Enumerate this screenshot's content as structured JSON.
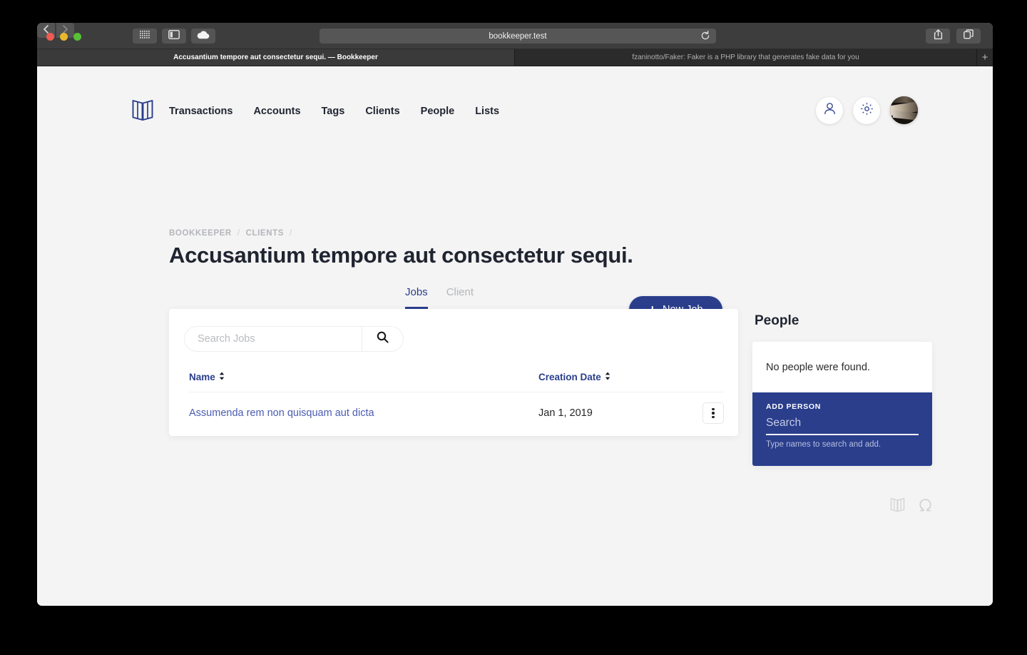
{
  "browser": {
    "address": "bookkeeper.test",
    "reload_icon": "reload-icon",
    "back_icon": "back-arrow-icon",
    "forward_icon": "forward-arrow-icon",
    "grid_icon": "app-grid-icon",
    "sidebar_icon": "sidebar-toggle-icon",
    "cloud_icon": "icloud-icon",
    "share_icon": "share-icon",
    "tab_overview_icon": "tab-overview-icon",
    "new_tab_label": "+",
    "tabs": [
      {
        "title": "Accusantium tempore aut consectetur sequi. — Bookkeeper",
        "active": true
      },
      {
        "title": "fzaninotto/Faker: Faker is a PHP library that generates fake data for you",
        "active": false
      }
    ]
  },
  "app": {
    "logo_icon": "open-book-logo-icon",
    "nav": [
      {
        "label": "Transactions"
      },
      {
        "label": "Accounts"
      },
      {
        "label": "Tags"
      },
      {
        "label": "Clients"
      },
      {
        "label": "People"
      },
      {
        "label": "Lists"
      }
    ],
    "actions": {
      "person_icon": "person-icon",
      "gear_icon": "gear-icon",
      "avatar_icon": "user-avatar"
    }
  },
  "breadcrumb": {
    "root": "BOOKKEEPER",
    "sep1": "/",
    "section": "CLIENTS",
    "sep2": "/"
  },
  "page": {
    "title": "Accusantium tempore aut consectetur sequi."
  },
  "tabs": [
    {
      "label": "Jobs",
      "active": true
    },
    {
      "label": "Client",
      "active": false
    }
  ],
  "new_job": {
    "plus": "+",
    "label": "New Job"
  },
  "jobs": {
    "search_placeholder": "Search Jobs",
    "search_value": "",
    "search_icon": "magnifier-icon",
    "columns": [
      {
        "label": "Name",
        "sort_icon": "sort-arrows-icon"
      },
      {
        "label": "Creation Date",
        "sort_icon": "sort-arrows-icon"
      }
    ],
    "rows": [
      {
        "name": "Assumenda rem non quisquam aut dicta",
        "date": "Jan 1, 2019",
        "menu_icon": "kebab-menu-icon"
      }
    ]
  },
  "people": {
    "title": "People",
    "empty_message": "No people were found.",
    "add_label": "ADD PERSON",
    "add_placeholder": "Search",
    "add_value": "",
    "hint": "Type names to search and add."
  },
  "footer": {
    "icons": [
      {
        "name": "open-book-icon"
      },
      {
        "name": "omega-icon"
      }
    ]
  },
  "colors": {
    "navy": "#2a3e8c",
    "link": "#4a5cb0",
    "text": "#1f2430",
    "muted": "#b4b6bb",
    "page_bg": "#f4f4f4"
  }
}
